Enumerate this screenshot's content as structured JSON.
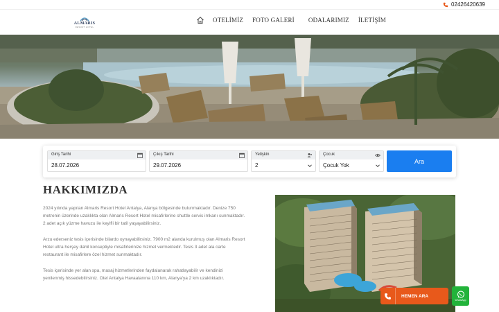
{
  "topbar": {
    "phone": "02426420639"
  },
  "brand": {
    "name": "ALMARIS",
    "tagline": "RESORT HOTEL"
  },
  "nav": {
    "items": [
      {
        "label": "OTELİMİZ"
      },
      {
        "label": "FOTO GALERİ"
      },
      {
        "label": "ODALARIMIZ"
      },
      {
        "label": "İLETİŞİM"
      }
    ]
  },
  "search": {
    "checkin": {
      "label": "Giriş Tarihi",
      "value": "28.07.2026"
    },
    "checkout": {
      "label": "Çıkış Tarihi",
      "value": "29.07.2026"
    },
    "adults": {
      "label": "Yetişkin",
      "value": "2"
    },
    "children": {
      "label": "Çocuk",
      "value": "Çocuk Yok"
    },
    "submit_label": "Ara"
  },
  "about": {
    "title": "HAKKIMIZDA",
    "paragraphs": [
      "2024 yılında yapılan Almaris Resort Hotel Antalya, Alanya bölgesinde bulunmaktadır. Denize 750 metrenin üzerinde uzaklıkta olan Almaris Resort Hotel misafirlerine shuttle servis imkanı sunmaktadır. 2 adet açık yüzme havuzu ile keyifli bir tatil yaşayabilirsiniz.",
      "Arzu ederseniz tesis içerisinde bilardo oynayabilirsiniz. 7900 m2 alanda kurulmuş olan Almaris Resort Hotel ultra herşey dahil konseptiyle misafirlerinize hizmet vermektedir. Tesis 3 adet ala carte restaurant ile misafirlere özel hizmet sunmaktadır.",
      "Tesis içerisinde yer alan spa, masaj hizmetlerinden faydalanarak rahatlayabilir ve kendinizi yenilenmiş hissedebilirsiniz. Otel Antalya Havaalanına 110 km, Alanya'ya 2 km uzaklıktadır."
    ]
  },
  "floating": {
    "call_label": "HEMEN ARA",
    "whatsapp_label": "WhatsApp"
  },
  "colors": {
    "accent": "#1a7ef0",
    "call": "#e8591b",
    "whatsapp": "#22b33a"
  }
}
